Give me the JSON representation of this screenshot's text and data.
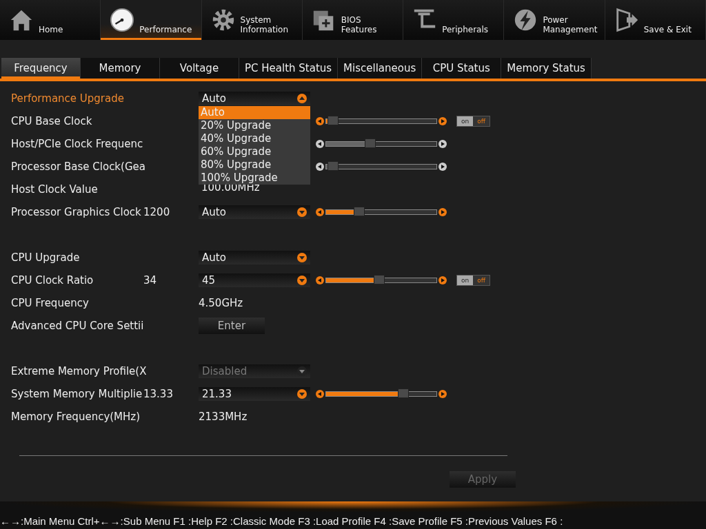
{
  "main_menu": [
    {
      "label": "Home",
      "selected": false
    },
    {
      "label": "Performance",
      "selected": true
    },
    {
      "label": "System\nInformation",
      "selected": false
    },
    {
      "label": "BIOS\nFeatures",
      "selected": false
    },
    {
      "label": "Peripherals",
      "selected": false
    },
    {
      "label": "Power\nManagement",
      "selected": false
    },
    {
      "label": "Save & Exit",
      "selected": false
    }
  ],
  "tabs": [
    {
      "label": "Frequency",
      "selected": true
    },
    {
      "label": "Memory",
      "selected": false
    },
    {
      "label": "Voltage",
      "selected": false
    },
    {
      "label": "PC Health Status",
      "selected": false
    },
    {
      "label": "Miscellaneous",
      "selected": false
    },
    {
      "label": "CPU Status",
      "selected": false
    },
    {
      "label": "Memory Status",
      "selected": false
    }
  ],
  "sections": [
    {
      "rows": [
        {
          "label": "Performance Upgrade",
          "selected": true,
          "control": {
            "kind": "dropdown",
            "value": "Auto",
            "open": true,
            "disabled": false
          }
        },
        {
          "label": "CPU Base Clock",
          "selected": false,
          "control": {
            "kind": "covered"
          },
          "slider": {
            "level": 0.06,
            "enabled": true
          },
          "toggle": {
            "on": false,
            "on_label": "on",
            "off_label": "off"
          }
        },
        {
          "label": "Host/PCIe Clock Frequenc",
          "selected": false,
          "control": {
            "kind": "covered"
          },
          "slider": {
            "level": 0.4,
            "enabled": false
          }
        },
        {
          "label": "Processor Base Clock(Gea",
          "selected": false,
          "control": {
            "kind": "covered"
          },
          "slider": {
            "level": 0.06,
            "enabled": false
          }
        },
        {
          "label": "Host Clock Value",
          "selected": false,
          "control": {
            "kind": "covered"
          }
        },
        {
          "label": "Processor Graphics Clock",
          "current": "1200",
          "selected": false,
          "control": {
            "kind": "dropdown",
            "value": "Auto",
            "open": false,
            "disabled": false
          },
          "slider": {
            "level": 0.3,
            "enabled": true
          }
        }
      ]
    },
    {
      "rows": [
        {
          "label": "CPU Upgrade",
          "selected": false,
          "control": {
            "kind": "dropdown",
            "value": "Auto",
            "open": false,
            "disabled": false
          }
        },
        {
          "label": "CPU Clock Ratio",
          "current": "34",
          "selected": false,
          "control": {
            "kind": "dropdown",
            "value": "45",
            "open": false,
            "disabled": false
          },
          "slider": {
            "level": 0.48,
            "enabled": true
          },
          "toggle": {
            "on": false,
            "on_label": "on",
            "off_label": "off"
          }
        },
        {
          "label": "CPU Frequency",
          "selected": false,
          "control": {
            "kind": "value",
            "value": "4.50GHz"
          }
        },
        {
          "label": "Advanced CPU Core Settii",
          "selected": false,
          "control": {
            "kind": "button",
            "value": "Enter"
          }
        }
      ]
    },
    {
      "rows": [
        {
          "label": "Extreme Memory Profile(X",
          "selected": false,
          "control": {
            "kind": "dropdown",
            "value": "Disabled",
            "open": false,
            "disabled": true
          }
        },
        {
          "label": "System Memory Multiplie",
          "current": "13.33",
          "selected": false,
          "control": {
            "kind": "dropdown",
            "value": "21.33",
            "open": false,
            "disabled": false
          },
          "slider": {
            "level": 0.7,
            "enabled": true
          }
        },
        {
          "label": "Memory Frequency(MHz)",
          "selected": false,
          "control": {
            "kind": "value",
            "value": "2133MHz"
          }
        }
      ]
    }
  ],
  "popup": {
    "options": [
      {
        "label": "Auto",
        "selected": true
      },
      {
        "label": "20% Upgrade",
        "selected": false
      },
      {
        "label": "40% Upgrade",
        "selected": false
      },
      {
        "label": "60% Upgrade",
        "selected": false
      },
      {
        "label": "80% Upgrade",
        "selected": false
      },
      {
        "label": "100% Upgrade",
        "selected": false
      }
    ],
    "covered_value": "100.00MHz"
  },
  "apply": {
    "label": "Apply",
    "disabled": true
  },
  "footer": "←→:Main Menu Ctrl+←→:Sub Menu F1 :Help F2 :Classic Mode F3 :Load Profile F4 :Save Profile F5 :Previous Values F6 :"
}
